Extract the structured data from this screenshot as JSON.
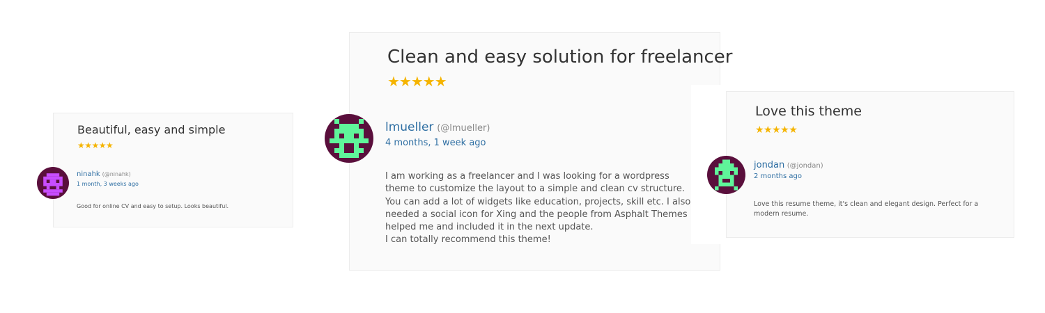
{
  "testimonials": [
    {
      "title": "Beautiful, easy and simple",
      "rating": 5,
      "stars": "★★★★★",
      "author": "ninahk",
      "handle": "(@ninahk)",
      "time": "1 month, 3 weeks ago",
      "body": [
        "Good for online CV and easy to setup. Looks beautiful."
      ],
      "avatar": {
        "icon": "identicon-avatar",
        "bg": "#5a0f3c",
        "fg": "#c84dff"
      }
    },
    {
      "title": "Clean and easy solution for freelancer",
      "rating": 5,
      "stars": "★★★★★",
      "author": "lmueller",
      "handle": "(@lmueller)",
      "time": "4 months, 1 week ago",
      "body": [
        "I am working as a freelancer and I was looking for a wordpress theme to customize the layout to a simple and clean cv structure.",
        "You can add a lot of widgets like education, projects, skill etc. I also needed a social icon for Xing and the people from Asphalt Themes helped me and included it in the next update.",
        "I can totally recommend this theme!"
      ],
      "avatar": {
        "icon": "identicon-avatar",
        "bg": "#5a0f3c",
        "fg": "#5ff59a"
      }
    },
    {
      "title": "Love this theme",
      "rating": 5,
      "stars": "★★★★★",
      "author": "jondan",
      "handle": "(@jondan)",
      "time": "2 months ago",
      "body": [
        "Love this resume theme, it's clean and elegant design. Perfect for a modern resume."
      ],
      "avatar": {
        "icon": "identicon-avatar",
        "bg": "#5a0f3c",
        "fg": "#5ff59a"
      }
    }
  ],
  "colors": {
    "star": "#f5b400",
    "link": "#2f6fa3",
    "card_bg": "#fafafa",
    "card_border": "#ececec"
  }
}
